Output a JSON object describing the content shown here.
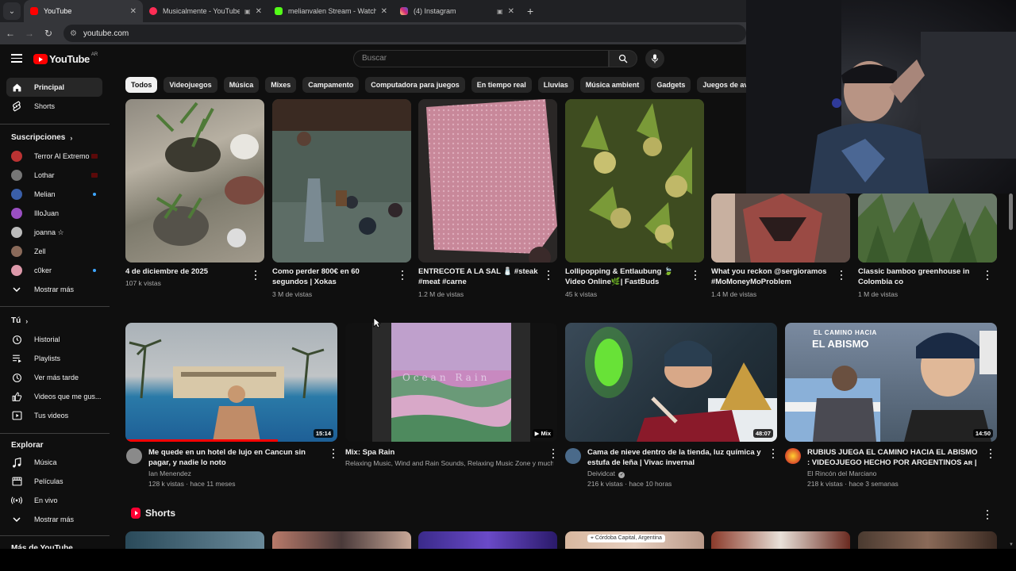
{
  "browser": {
    "tabs": [
      {
        "title": "YouTube",
        "favicon_color": "#ff0000",
        "active": true
      },
      {
        "title": "Musicalmente - YouTube M",
        "favicon_color": "#ff2d55",
        "active": false
      },
      {
        "title": "melianvalen Stream - Watch Liv",
        "favicon_color": "#53fc18",
        "active": false
      },
      {
        "title": "(4) Instagram",
        "favicon_color": "#d62976",
        "active": false
      }
    ],
    "url": "youtube.com"
  },
  "header": {
    "logo_text": "YouTube",
    "country_code": "AR",
    "search_placeholder": "Buscar"
  },
  "chips": [
    "Todos",
    "Videojuegos",
    "Música",
    "Mixes",
    "Campamento",
    "Computadora para juegos",
    "En tiempo real",
    "Lluvias",
    "Música ambient",
    "Gadgets",
    "Juegos de aventura y acción"
  ],
  "sidebar": {
    "main": [
      {
        "label": "Principal",
        "icon": "home-icon"
      },
      {
        "label": "Shorts",
        "icon": "shorts-icon"
      }
    ],
    "subscriptions_title": "Suscripciones",
    "subscriptions": [
      {
        "label": "Terror Al Extremo",
        "color": "#b33",
        "badge": "live"
      },
      {
        "label": "Lothar",
        "color": "#777",
        "badge": "live"
      },
      {
        "label": "Melian",
        "color": "#3a5fa8",
        "badge": "dot"
      },
      {
        "label": "IlloJuan",
        "color": "#9a4fc2",
        "badge": ""
      },
      {
        "label": "joanna ☆",
        "color": "#bbb",
        "badge": ""
      },
      {
        "label": "Zell",
        "color": "#8a6a5a",
        "badge": ""
      },
      {
        "label": "c0ker",
        "color": "#d9a",
        "badge": "dot"
      }
    ],
    "subs_more": "Mostrar más",
    "you_title": "Tú",
    "you": [
      {
        "label": "Historial",
        "icon": "history-icon"
      },
      {
        "label": "Playlists",
        "icon": "playlists-icon"
      },
      {
        "label": "Ver más tarde",
        "icon": "watch-later-icon"
      },
      {
        "label": "Videos que me gus...",
        "icon": "like-icon"
      },
      {
        "label": "Tus videos",
        "icon": "your-videos-icon"
      }
    ],
    "explore_title": "Explorar",
    "explore": [
      {
        "label": "Música",
        "icon": "music-icon"
      },
      {
        "label": "Películas",
        "icon": "movies-icon"
      },
      {
        "label": "En vivo",
        "icon": "live-icon"
      }
    ],
    "explore_more": "Mostrar más",
    "more_title": "Más de YouTube"
  },
  "row1": [
    {
      "title": "4 de diciembre de 2025",
      "meta": "107 k vistas"
    },
    {
      "title": "Como perder 800€ en 60 segundos | Xokas",
      "meta": "3 M de vistas"
    },
    {
      "title": "ENTRECOTE A LA SAL 🧂 #steak #meat #carne",
      "meta": "1.2 M de vistas"
    },
    {
      "title": "Lollipopping & Entlaubung 🍃Video Online🌿| FastBuds Autoflower ...",
      "meta": "45 k vistas"
    },
    {
      "title": "What you reckon @sergioramos #MoMoneyMoProblem",
      "meta": "1.4 M de vistas"
    },
    {
      "title": "Classic bamboo greenhouse in Colombia co",
      "meta": "1 M de vistas"
    }
  ],
  "row2": [
    {
      "title": "Me quede en un hotel de lujo en Cancun sin pagar, y nadie lo noto",
      "channel": "Ian Menendez",
      "meta": "128 k vistas · hace 11 meses",
      "duration": "15:14",
      "verified": false,
      "avatar_color": "#8a8a8a"
    },
    {
      "title": "Mix: Spa Rain",
      "channel": "Relaxing Music, Wind and Rain Sounds, Relaxing Music Zone y mucho...",
      "meta": "",
      "duration": "Mix",
      "verified": false,
      "avatar_color": ""
    },
    {
      "title": "Cama de nieve dentro de la tienda, luz química y estufa de leña | Vivac invernal",
      "channel": "Deividcat",
      "meta": "216 k vistas · hace 10 horas",
      "duration": "48:07",
      "verified": true,
      "avatar_color": "#4a6a8a"
    },
    {
      "title": "RUBIUS JUEGA EL CAMINO HACIA EL ABISMO : VIDEOJUEGO HECHO POR ARGENTINOS ᴀʀ | ...",
      "channel": "El Rincón del Marciano",
      "meta": "218 k vistas · hace 3 semanas",
      "duration": "14:50",
      "verified": false,
      "avatar_color": "#d88a2a"
    }
  ],
  "thumb_texts": {
    "spa_rain": "Ocean Rain",
    "abismo_top": "EL CAMINO HACIA",
    "abismo_big": "EL ABISMO",
    "shorts_location": "Córdoba Capital, Argentina"
  },
  "shorts_title": "Shorts"
}
